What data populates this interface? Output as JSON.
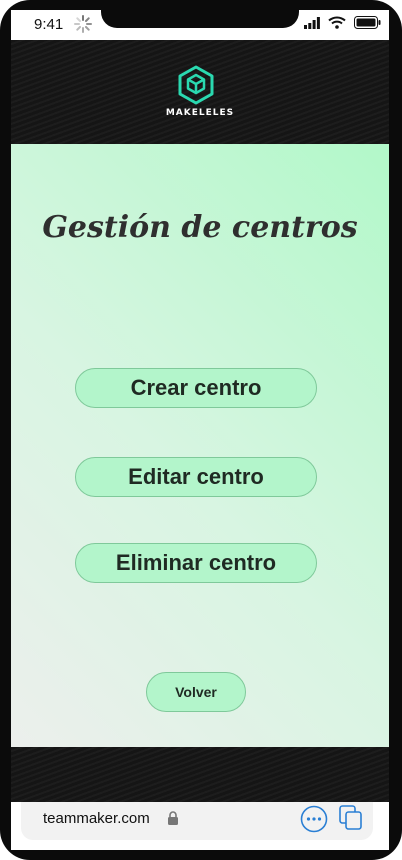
{
  "status_bar": {
    "time": "9:41",
    "icons": [
      "loading-spinner-icon",
      "signal-icon",
      "wifi-icon",
      "battery-icon"
    ]
  },
  "header": {
    "logo_icon": "cube-hexagon-icon",
    "brand": "MAKELELES",
    "accent_color": "#2ad9b0"
  },
  "page": {
    "title": "Gestión de centros"
  },
  "actions": {
    "create_label": "Crear centro",
    "edit_label": "Editar centro",
    "delete_label": "Eliminar centro",
    "back_label": "Volver"
  },
  "browser": {
    "url": "teammaker.com",
    "icons": [
      "lock-icon",
      "more-icon",
      "tabs-icon"
    ],
    "accent_color": "#2a7fd4"
  },
  "colors": {
    "button_fill": "#b3f5cb",
    "button_border": "#7fc99a",
    "background_gradient_start": "#ecefec",
    "background_gradient_end": "#b2f8c9"
  }
}
